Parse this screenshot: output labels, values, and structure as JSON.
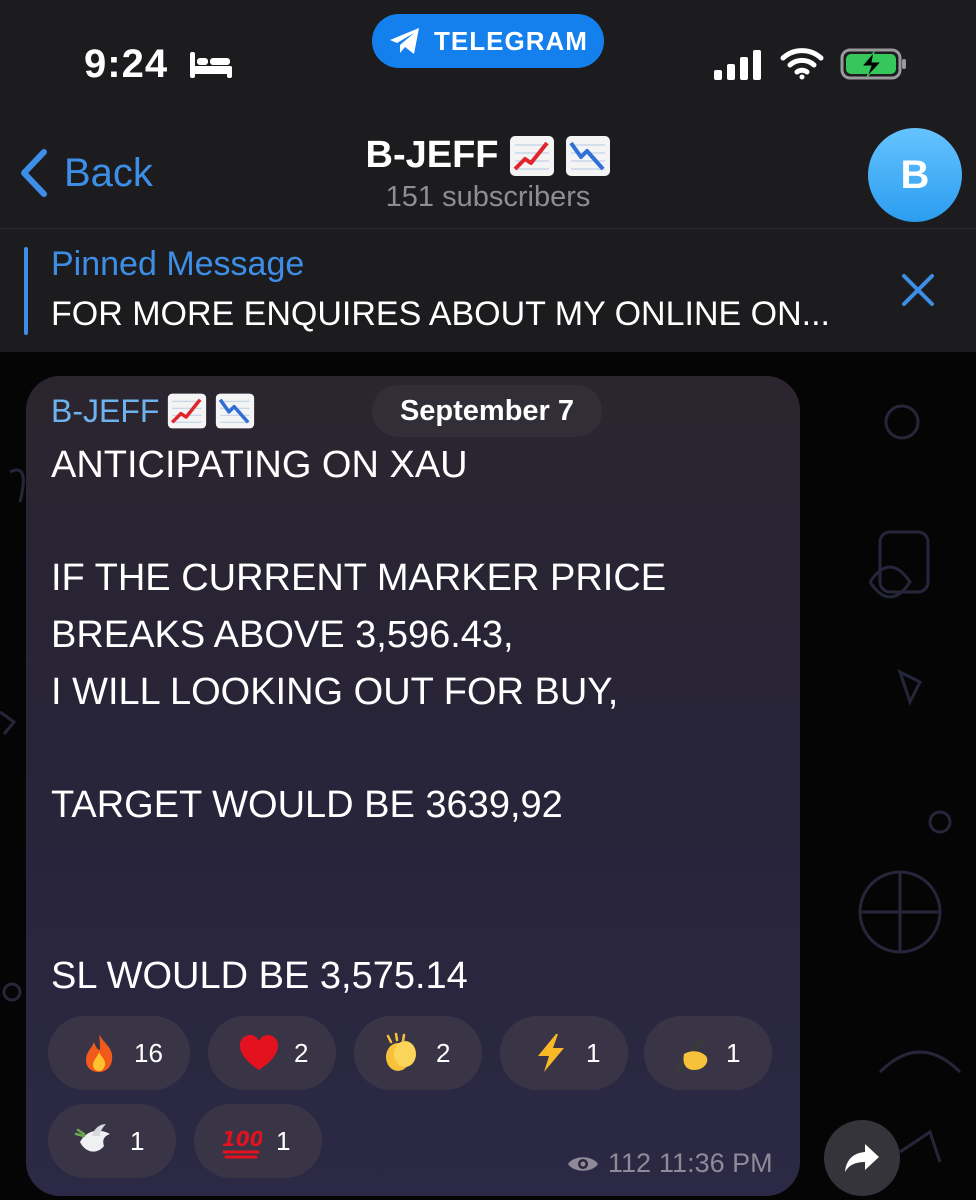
{
  "status_bar": {
    "time": "9:24",
    "pill_label": "TELEGRAM",
    "icons": [
      "bed-icon",
      "telegram-plane-icon",
      "signal-icon",
      "wifi-icon",
      "battery-charging-icon"
    ]
  },
  "nav": {
    "back_label": "Back",
    "channel_name": "B-JEFF",
    "name_emojis": [
      "chart-increasing-icon",
      "chart-decreasing-icon"
    ],
    "subscribers": "151 subscribers",
    "avatar_letter": "B"
  },
  "pinned": {
    "title": "Pinned Message",
    "text": "FOR MORE ENQUIRES ABOUT MY ONLINE ON..."
  },
  "message": {
    "sender": "B-JEFF",
    "date": "September 7",
    "lines": [
      "ANTICIPATING ON XAU",
      "",
      "IF THE CURRENT MARKER PRICE",
      "BREAKS ABOVE 3,596.43,",
      "I WILL LOOKING OUT FOR BUY,",
      "",
      "TARGET WOULD BE 3639,92",
      "",
      "",
      "SL WOULD BE 3,575.14"
    ],
    "reactions": [
      {
        "icon": "fire-icon",
        "count": "16"
      },
      {
        "icon": "heart-icon",
        "count": "2"
      },
      {
        "icon": "clapping-hands-icon",
        "count": "2"
      },
      {
        "icon": "lightning-icon",
        "count": "1"
      },
      {
        "icon": "writing-hand-icon",
        "count": "1"
      },
      {
        "icon": "dove-icon",
        "count": "1"
      },
      {
        "icon": "hundred-points-icon",
        "count": "1"
      }
    ],
    "views": "112",
    "time": "11:36 PM"
  },
  "colors": {
    "accent": "#3d8ee6",
    "pill": "#1480ee",
    "bar_bg": "#1c1c1e",
    "bubble": "#2a2638"
  }
}
